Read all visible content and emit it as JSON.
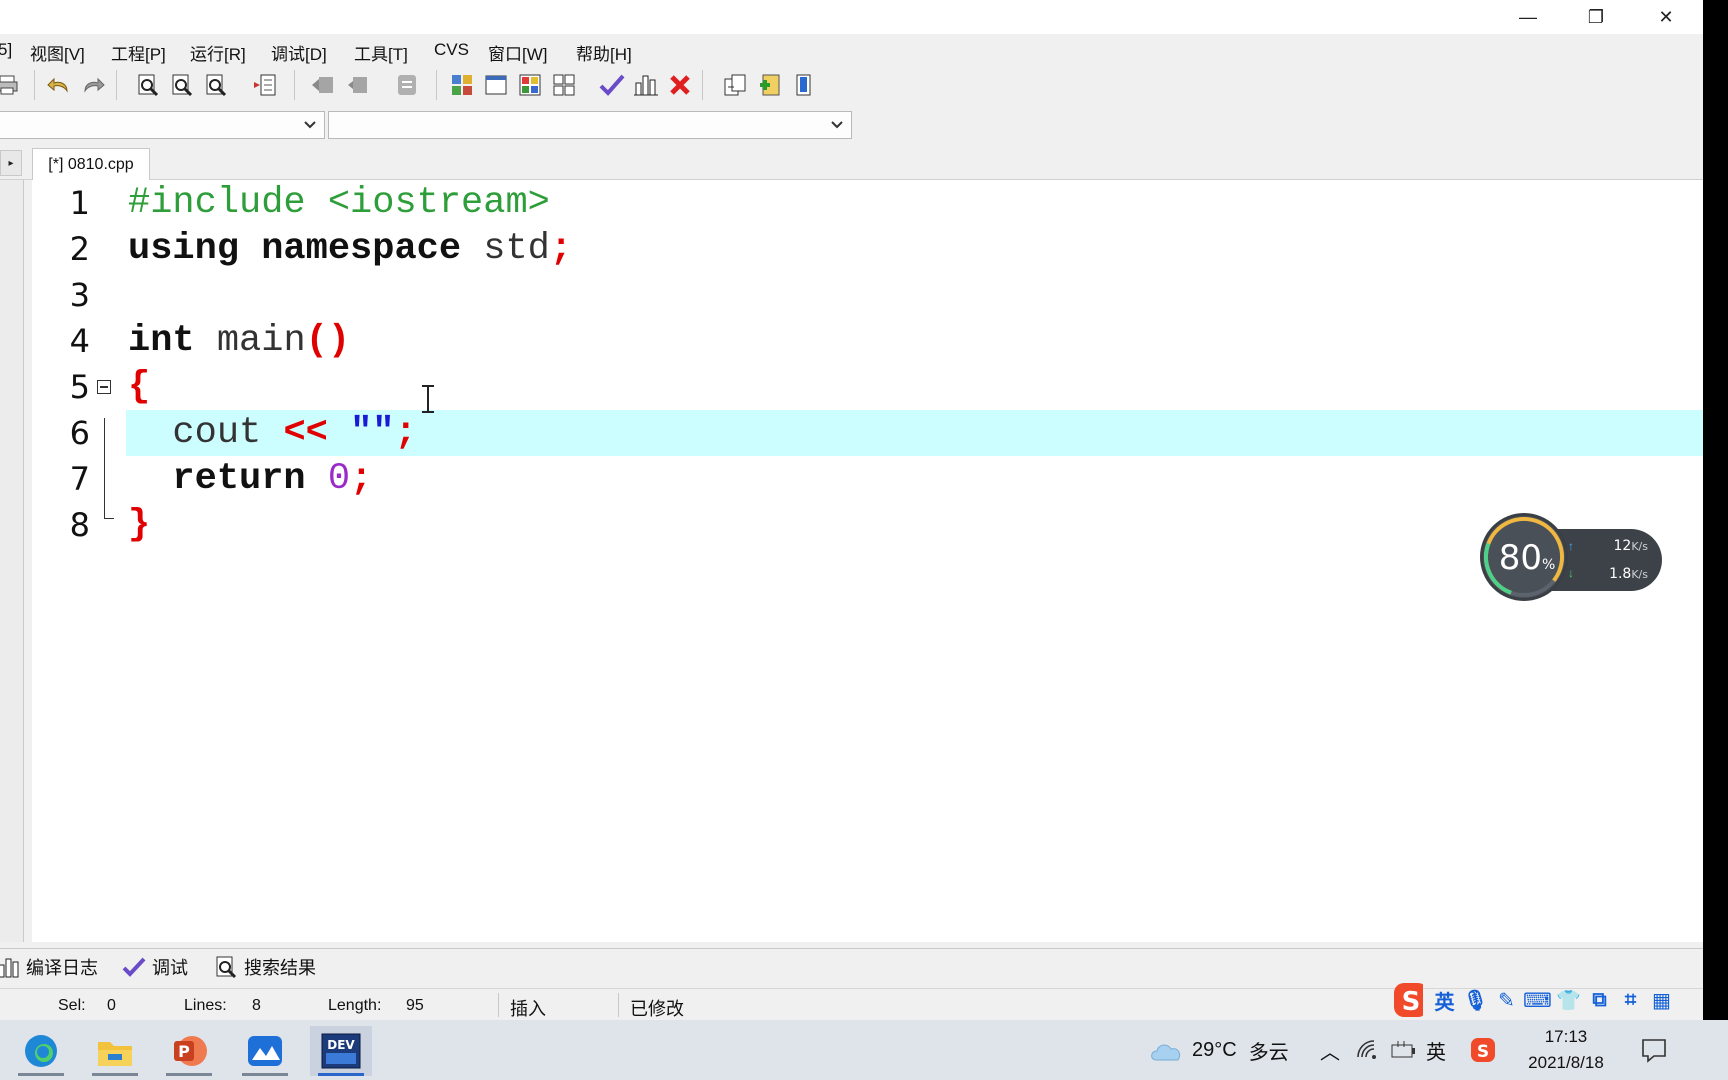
{
  "menu": {
    "items": [
      "5]",
      "视图[V]",
      "工程[P]",
      "运行[R]",
      "调试[D]",
      "工具[T]",
      "CVS",
      "窗口[W]",
      "帮助[H]"
    ]
  },
  "window_controls": {
    "minimize": "—",
    "restore": "❐",
    "close": "✕"
  },
  "editor": {
    "tab_label": "[*] 0810.cpp",
    "side_arrow": "▸",
    "lines": [
      {
        "n": "1"
      },
      {
        "n": "2"
      },
      {
        "n": "3"
      },
      {
        "n": "4"
      },
      {
        "n": "5"
      },
      {
        "n": "6"
      },
      {
        "n": "7"
      },
      {
        "n": "8"
      }
    ],
    "code": {
      "l1": "#include <iostream>",
      "l2_kw": "using namespace",
      "l2_id": " std",
      "l2_semi": ";",
      "l4_kw": "int",
      "l4_id": " main",
      "l4_paren": "()",
      "l5_brace": "{",
      "l6_id": "  cout ",
      "l6_op": "<<",
      "l6_str": " \"\"",
      "l6_semi": ";",
      "l7_kw": "  return",
      "l7_num": " 0",
      "l7_semi": ";",
      "l8_brace": "}"
    },
    "highlight_color": "#ccfdff"
  },
  "net_widget": {
    "percent": "80",
    "percent_unit": "%",
    "up_speed": "12",
    "down_speed": "1.8",
    "unit": "K/s"
  },
  "bottom_tabs": [
    "编译日志",
    "调试",
    "搜索结果"
  ],
  "status": {
    "sel_label": "Sel:",
    "sel_value": "0",
    "lines_label": "Lines:",
    "lines_value": "8",
    "length_label": "Length:",
    "length_value": "95",
    "mode": "插入",
    "modified": "已修改"
  },
  "ime": {
    "lang": "英"
  },
  "taskbar": {
    "weather_temp": "29°C",
    "weather_desc": "多云",
    "time": "17:13",
    "date": "2021/8/18",
    "tray_ime": "英",
    "devcpp_label": "DEV"
  },
  "colors": {
    "keyword": "#111111",
    "preprocessor": "#2e9e3a",
    "symbol": "#e00000",
    "string": "#1a1ad6",
    "number": "#9a2bc8"
  }
}
